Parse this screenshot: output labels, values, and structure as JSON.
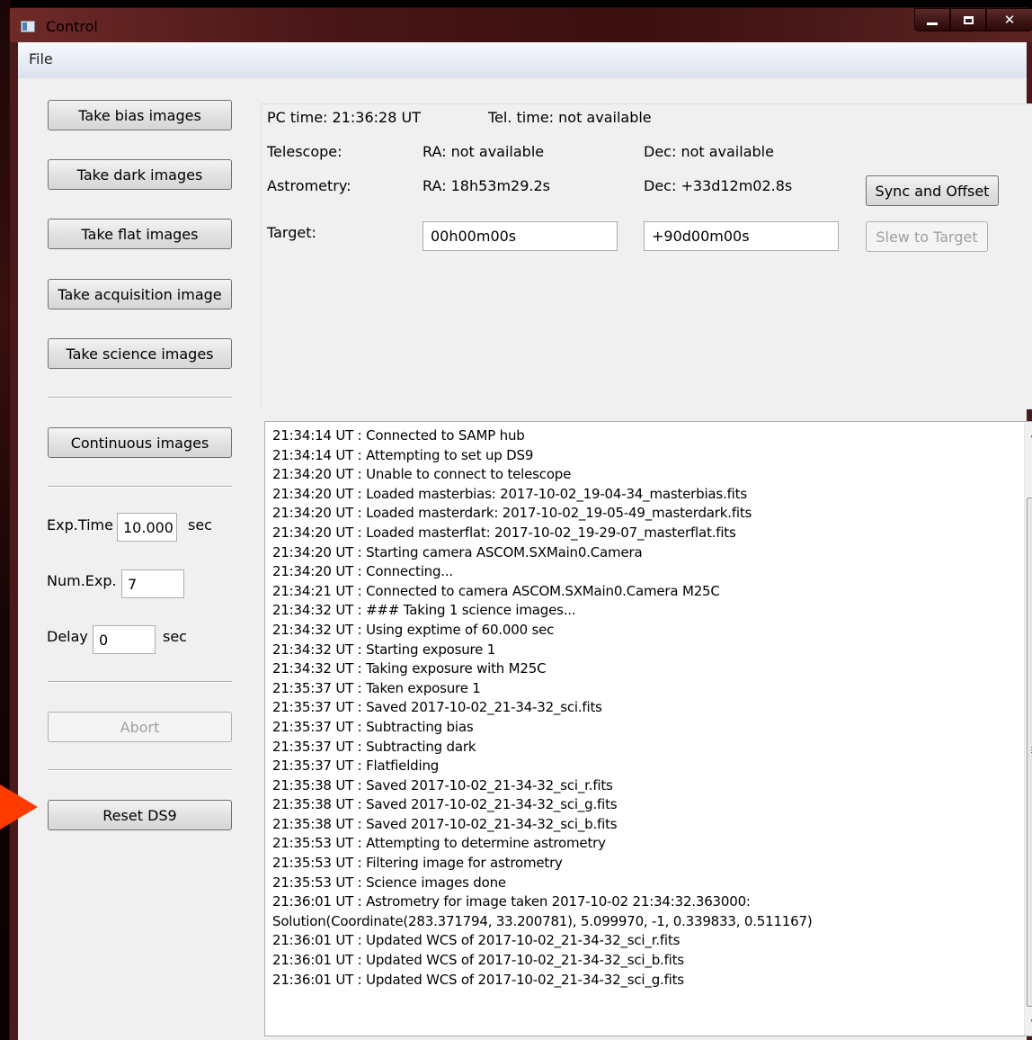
{
  "window": {
    "title": "Control"
  },
  "menu": {
    "file": "File"
  },
  "actions": {
    "bias": "Take bias images",
    "dark": "Take dark images",
    "flat": "Take flat images",
    "acquisition": "Take acquisition image",
    "science": "Take science images",
    "continuous": "Continuous images",
    "abort": "Abort",
    "reset": "Reset DS9"
  },
  "exposure": {
    "time_label": "Exp.Time",
    "time_value": "10.000",
    "time_unit": "sec",
    "num_label": "Num.Exp.",
    "num_value": "7",
    "delay_label": "Delay",
    "delay_value": "0",
    "delay_unit": "sec"
  },
  "status": {
    "pc_time": "PC time:  21:36:28 UT",
    "tel_time": "Tel. time:  not available",
    "telescope_label": "Telescope:",
    "telescope_ra": "RA:  not available",
    "telescope_dec": "Dec:  not available",
    "astrometry_label": "Astrometry:",
    "astrometry_ra": "RA:  18h53m29.2s",
    "astrometry_dec": "Dec:  +33d12m02.8s",
    "target_label": "Target:",
    "target_ra": "00h00m00s",
    "target_dec": "+90d00m00s",
    "sync_button": "Sync and Offset",
    "slew_button": "Slew to Target"
  },
  "log": {
    "lines": [
      "21:34:14 UT : Connected to SAMP hub",
      "21:34:14 UT : Attempting to set up DS9",
      "21:34:20 UT : Unable to connect to telescope",
      "21:34:20 UT : Loaded masterbias: 2017-10-02_19-04-34_masterbias.fits",
      "21:34:20 UT : Loaded masterdark: 2017-10-02_19-05-49_masterdark.fits",
      "21:34:20 UT : Loaded masterflat: 2017-10-02_19-29-07_masterflat.fits",
      "21:34:20 UT : Starting camera ASCOM.SXMain0.Camera",
      "21:34:20 UT : Connecting...",
      "21:34:21 UT : Connected to camera ASCOM.SXMain0.Camera M25C",
      "21:34:32 UT : ### Taking 1 science images...",
      "21:34:32 UT : Using exptime of 60.000 sec",
      "21:34:32 UT : Starting exposure 1",
      "21:34:32 UT : Taking exposure with M25C",
      "21:35:37 UT : Taken exposure 1",
      "21:35:37 UT : Saved 2017-10-02_21-34-32_sci.fits",
      "21:35:37 UT : Subtracting bias",
      "21:35:37 UT : Subtracting dark",
      "21:35:37 UT : Flatfielding",
      "21:35:38 UT : Saved 2017-10-02_21-34-32_sci_r.fits",
      "21:35:38 UT : Saved 2017-10-02_21-34-32_sci_g.fits",
      "21:35:38 UT : Saved 2017-10-02_21-34-32_sci_b.fits",
      "21:35:53 UT : Attempting to determine astrometry",
      "21:35:53 UT : Filtering image for astrometry",
      "21:35:53 UT : Science images done",
      "21:36:01 UT : Astrometry for image taken 2017-10-02 21:34:32.363000:",
      "Solution(Coordinate(283.371794, 33.200781), 5.099970, -1, 0.339833, 0.511167)",
      "21:36:01 UT : Updated WCS of 2017-10-02_21-34-32_sci_r.fits",
      "21:36:01 UT : Updated WCS of 2017-10-02_21-34-32_sci_b.fits",
      "21:36:01 UT : Updated WCS of 2017-10-02_21-34-32_sci_g.fits"
    ]
  },
  "icons": {
    "app": "window-app-icon",
    "minimize": "minimize-icon",
    "maximize": "maximize-icon",
    "close": "close-icon",
    "scroll_up": "scroll-up-icon",
    "scroll_down": "scroll-down-icon",
    "annotation": "red-arrow-annotation"
  },
  "colors": {
    "annotation": "#ff3b00",
    "titlebar": "#4a1718"
  }
}
